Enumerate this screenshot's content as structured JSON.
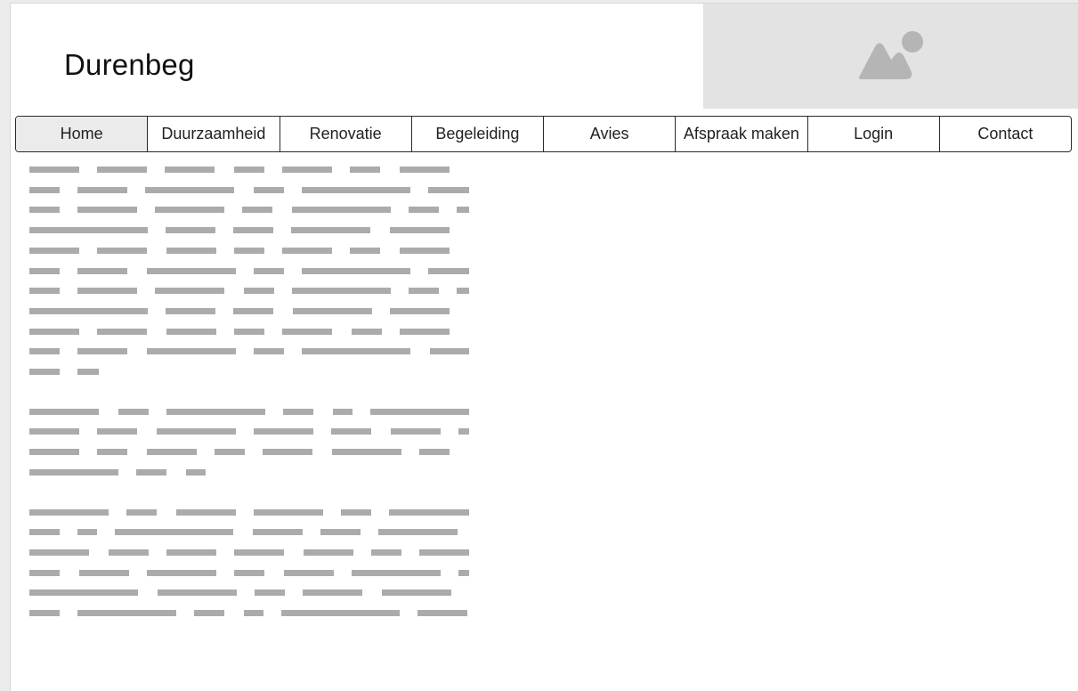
{
  "header": {
    "site_title": "Durenbeg"
  },
  "hero_image": {
    "icon": "image-placeholder-icon"
  },
  "nav": {
    "items": [
      {
        "label": "Home",
        "active": true
      },
      {
        "label": "Duurzaamheid",
        "active": false
      },
      {
        "label": "Renovatie",
        "active": false
      },
      {
        "label": "Begeleiding",
        "active": false
      },
      {
        "label": "Avies",
        "active": false
      },
      {
        "label": "Afspraak maken",
        "active": false
      },
      {
        "label": "Login",
        "active": false
      },
      {
        "label": "Contact",
        "active": false
      }
    ]
  },
  "content": {
    "paragraphs": [
      {
        "lines": 11
      },
      {
        "lines": 4
      },
      {
        "lines": 6
      }
    ]
  },
  "colors": {
    "placeholder_text_bar": "#ababab",
    "hero_background": "#e3e3e3",
    "hero_icon": "#b5b5b5",
    "active_nav_background": "#ebebeb"
  }
}
